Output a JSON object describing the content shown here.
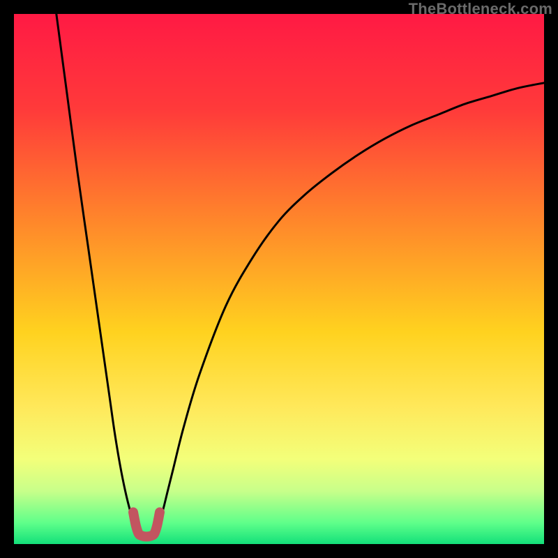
{
  "watermark": "TheBottleneck.com",
  "chart_data": {
    "type": "line",
    "title": "",
    "xlabel": "",
    "ylabel": "",
    "xlim": [
      0,
      100
    ],
    "ylim": [
      0,
      100
    ],
    "grid": false,
    "gradient_stops": [
      {
        "offset": 0,
        "color": "#ff1a44"
      },
      {
        "offset": 18,
        "color": "#ff3a3a"
      },
      {
        "offset": 40,
        "color": "#ff8a2a"
      },
      {
        "offset": 60,
        "color": "#ffd21f"
      },
      {
        "offset": 74,
        "color": "#ffe85a"
      },
      {
        "offset": 84,
        "color": "#f3ff7a"
      },
      {
        "offset": 90,
        "color": "#c8ff8a"
      },
      {
        "offset": 96,
        "color": "#5fff8a"
      },
      {
        "offset": 100,
        "color": "#13e07a"
      }
    ],
    "series": [
      {
        "name": "left-branch",
        "x": [
          8,
          10,
          12,
          14,
          16,
          18,
          19,
          20,
          21,
          22,
          23
        ],
        "y": [
          100,
          85,
          70,
          56,
          42,
          28,
          21,
          15,
          10,
          6,
          3
        ]
      },
      {
        "name": "right-branch",
        "x": [
          27,
          28,
          29,
          30,
          32,
          35,
          40,
          45,
          50,
          55,
          60,
          65,
          70,
          75,
          80,
          85,
          90,
          95,
          100
        ],
        "y": [
          3,
          6,
          10,
          14,
          22,
          32,
          45,
          54,
          61,
          66,
          70,
          73.5,
          76.5,
          79,
          81,
          83,
          84.5,
          86,
          87
        ]
      },
      {
        "name": "valley-marker",
        "x": [
          22.5,
          23,
          23.5,
          24,
          25,
          26,
          26.5,
          27,
          27.5
        ],
        "y": [
          6,
          3.5,
          2,
          1.6,
          1.4,
          1.6,
          2,
          3.5,
          6
        ]
      }
    ],
    "valley_x": 25,
    "annotations": []
  }
}
